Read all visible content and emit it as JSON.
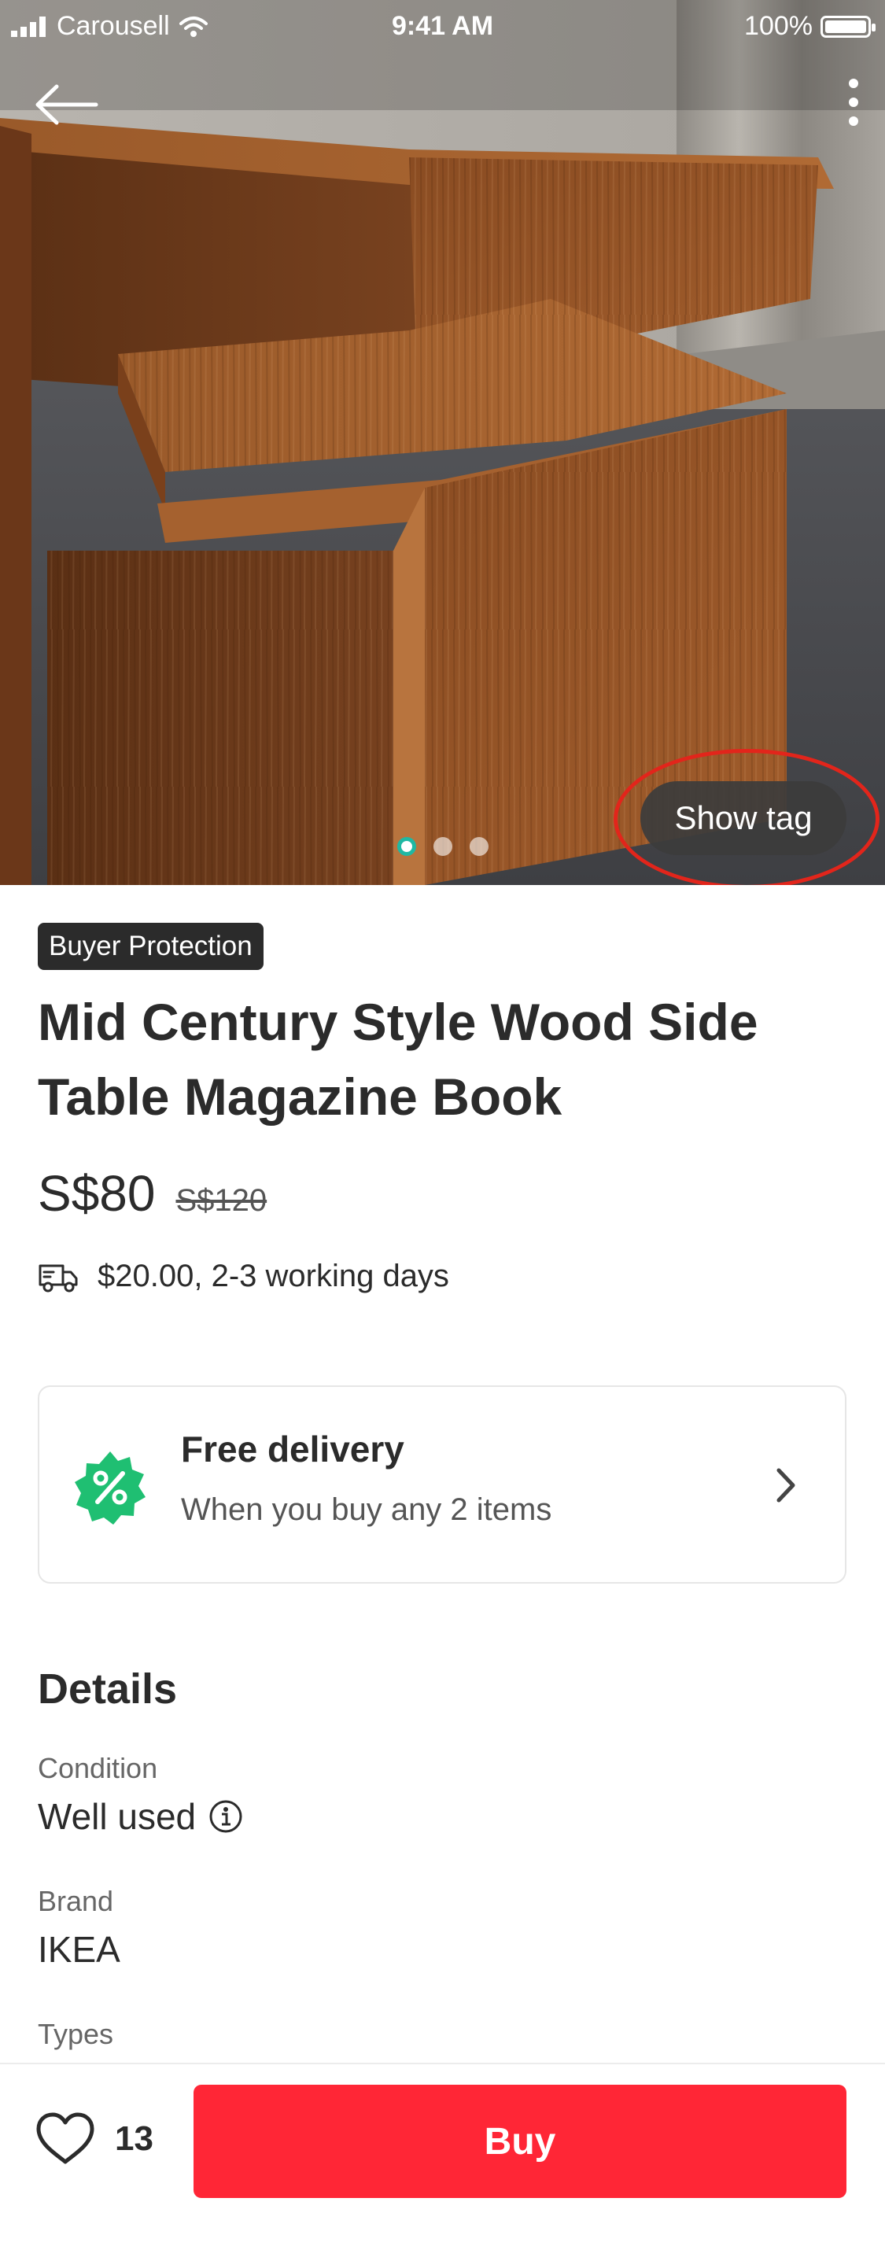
{
  "status_bar": {
    "carrier": "Carousell",
    "time": "9:41 AM",
    "battery": "100%"
  },
  "hero": {
    "show_tag_label": "Show tag",
    "photo_count": 3,
    "active_photo_index": 0
  },
  "listing": {
    "badge": "Buyer Protection",
    "title": "Mid Century Style Wood Side Table Magazine Book",
    "price": "S$80",
    "original_price": "S$120",
    "shipping": "$20.00, 2-3 working days"
  },
  "promo": {
    "title": "Free delivery",
    "subtitle": "When you buy any 2 items",
    "icon": "percent-badge-icon"
  },
  "details": {
    "heading": "Details",
    "items": [
      {
        "label": "Condition",
        "value": "Well used"
      },
      {
        "label": "Brand",
        "value": "IKEA"
      },
      {
        "label": "Types",
        "value": ""
      }
    ]
  },
  "bottom_bar": {
    "like_count": "13",
    "buy_label": "Buy"
  },
  "colors": {
    "accent_red": "#ff2636",
    "promo_green": "#1fbf72",
    "tag_highlight": "#e2251b",
    "text_dark": "#2b2b2b"
  }
}
